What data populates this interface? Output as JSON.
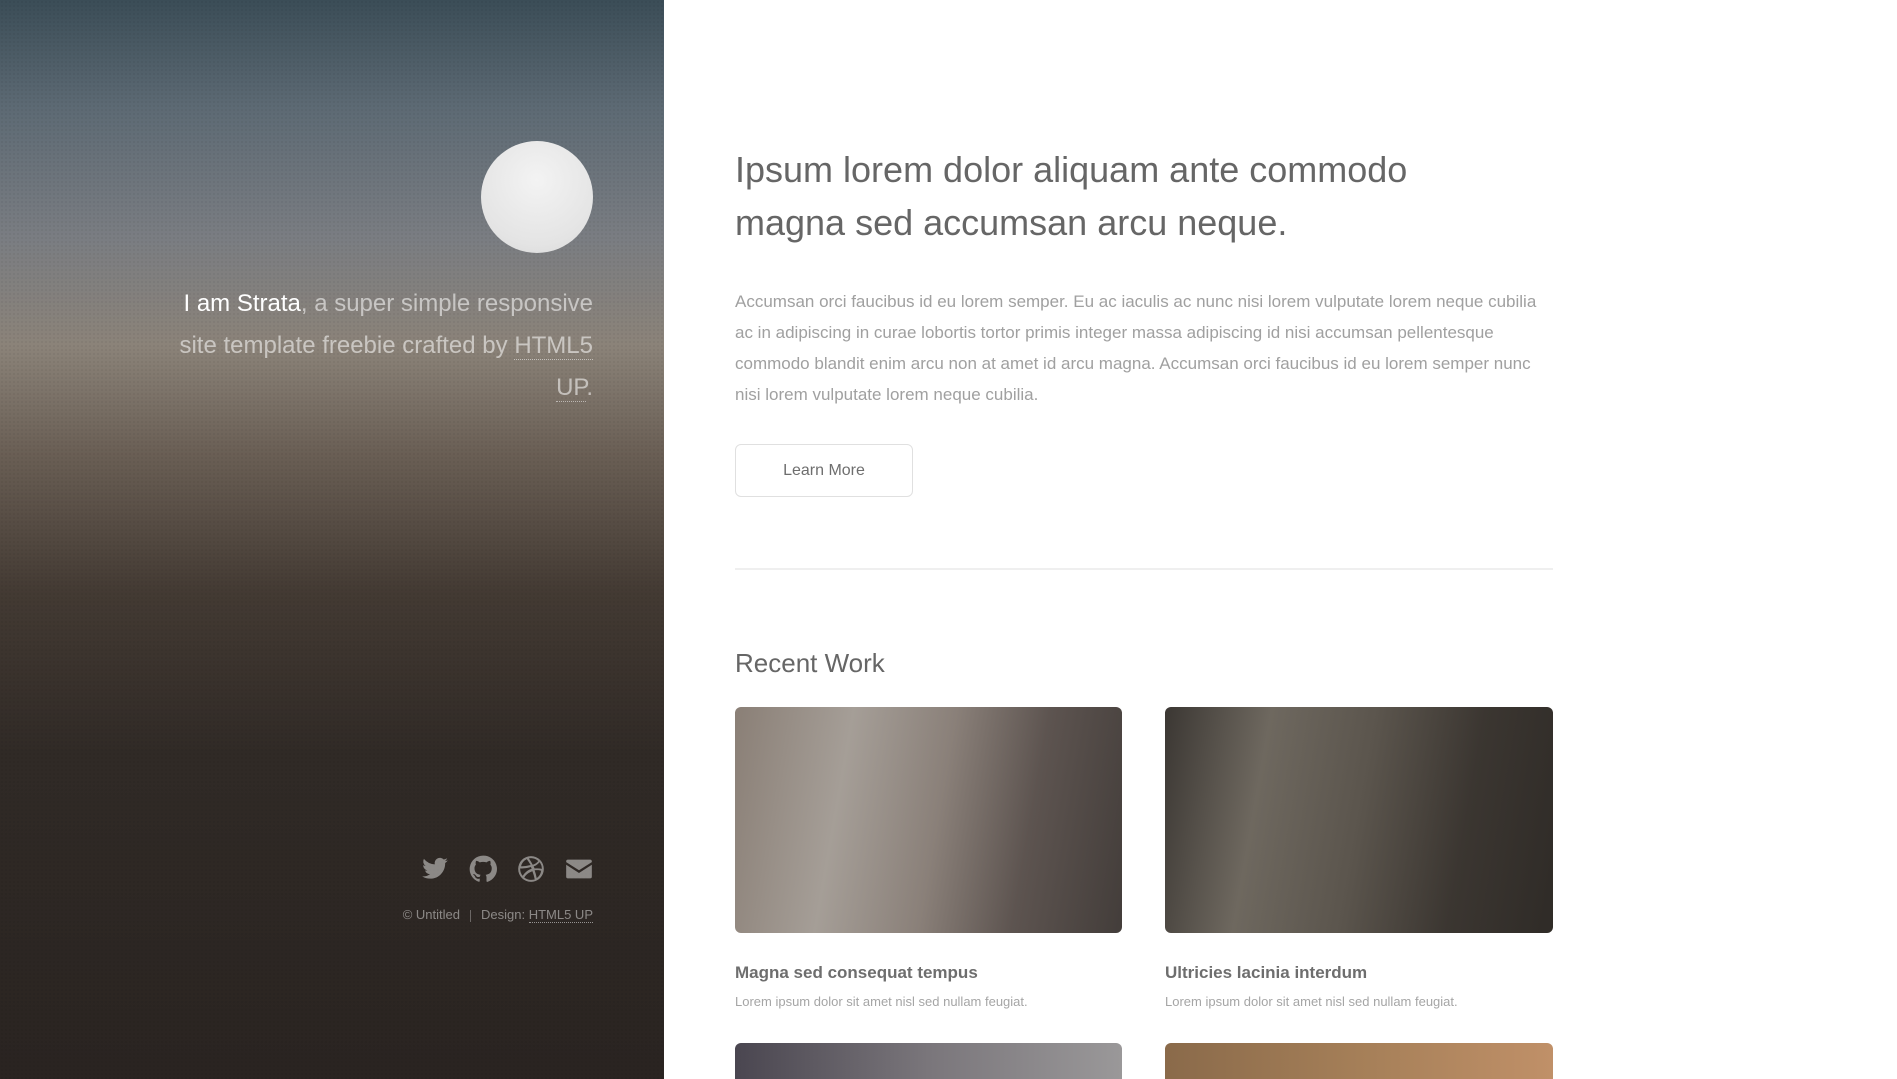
{
  "sidebar": {
    "intro_name": "I am Strata",
    "intro_rest": ", a super simple responsive site template freebie crafted by ",
    "intro_link": "HTML5 UP",
    "intro_end": ".",
    "social_icons": [
      "twitter-icon",
      "github-icon",
      "dribbble-icon",
      "envelope-icon"
    ],
    "copyright": "© Untitled",
    "design_label": "Design: ",
    "design_link": "HTML5 UP"
  },
  "main": {
    "headline_line1": "Ipsum lorem dolor aliquam ante commodo",
    "headline_line2": "magna sed accumsan arcu neque.",
    "body": "Accumsan orci faucibus id eu lorem semper. Eu ac iaculis ac nunc nisi lorem vulputate lorem neque cubilia ac in adipiscing in curae lobortis tortor primis integer massa adipiscing id nisi accumsan pellentesque commodo blandit enim arcu non at amet id arcu magna. Accumsan orci faucibus id eu lorem semper nunc nisi lorem vulputate lorem neque cubilia.",
    "button_label": "Learn More",
    "section_title": "Recent Work",
    "works": [
      {
        "title": "Magna sed consequat tempus",
        "desc": "Lorem ipsum dolor sit amet nisl sed nullam feugiat."
      },
      {
        "title": "Ultricies lacinia interdum",
        "desc": "Lorem ipsum dolor sit amet nisl sed nullam feugiat."
      }
    ]
  }
}
